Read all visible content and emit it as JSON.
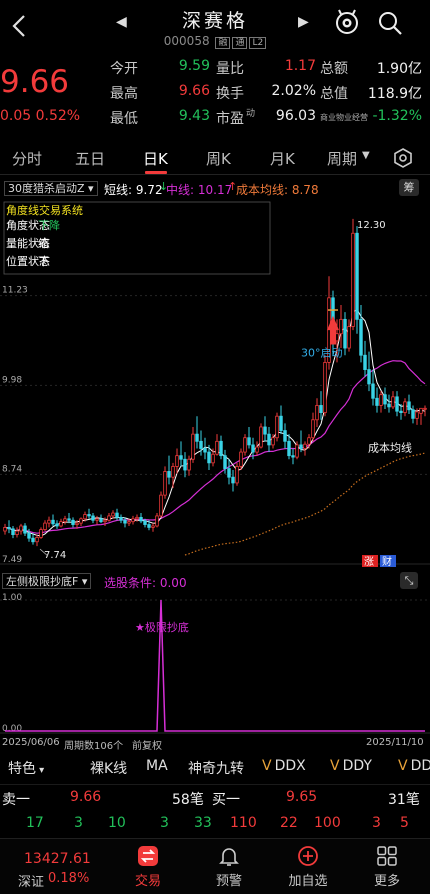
{
  "header": {
    "title": "深赛格",
    "code": "000058",
    "tags": [
      "融",
      "通",
      "L2"
    ]
  },
  "quote": {
    "price": "9.66",
    "change": "0.05",
    "change_pct": "0.52%",
    "rows": [
      {
        "l1": "今开",
        "v1": "9.59",
        "c1": "green",
        "l2": "量比",
        "v2": "1.17",
        "c2": "red",
        "l3": "总额",
        "v3": "1.90亿",
        "c3": "white"
      },
      {
        "l1": "最高",
        "v1": "9.66",
        "c1": "red",
        "l2": "换手",
        "v2": "2.02%",
        "c2": "white",
        "l3": "总值",
        "v3": "118.9亿",
        "c3": "white"
      },
      {
        "l1": "最低",
        "v1": "9.43",
        "c1": "green",
        "l2": "市盈",
        "v2": "96.03",
        "c2": "white",
        "l3": "商业物业经营",
        "v3": "-1.32%",
        "c3": "green"
      }
    ],
    "pe_sup": "动"
  },
  "tabs": [
    "分时",
    "五日",
    "日K",
    "周K",
    "月K",
    "周期"
  ],
  "active_tab": "日K",
  "indicator": {
    "name": "30度猎杀启动Z",
    "short_label": "短线: 9.72",
    "mid_label": "中线: 10.17",
    "cost_label": "成本均线: 8.78",
    "side_btn": "筹"
  },
  "overlay": {
    "title": "角度线交易系统",
    "rows": [
      "角度状态",
      "量能状态",
      "位置状态"
    ],
    "vals": [
      "下降",
      "缩",
      "下"
    ],
    "launch": "30°启动",
    "cost_avg": "成本均线",
    "zhang": "涨",
    "cai": "财",
    "max_label": "12.30",
    "min_label": "7.74"
  },
  "chart_data": [
    {
      "type": "candlestick",
      "title": "30度猎杀启动Z",
      "y_ticks": [
        "11.23",
        "9.98",
        "8.74",
        "7.49"
      ],
      "ylim": [
        7.49,
        12.48
      ],
      "x_start": "2025/06/06",
      "x_end": "2025/11/10",
      "period_count": "周期数106个",
      "adjust": "前复权",
      "high_marker": "12.30",
      "low_marker": "7.74",
      "series": [
        {
          "name": "短线",
          "value": 9.72,
          "color": "#ffffff"
        },
        {
          "name": "中线",
          "value": 10.17,
          "color": "#d62fd6"
        },
        {
          "name": "成本均线",
          "value": 8.78,
          "color": "#c86f1e"
        }
      ],
      "candles": [
        [
          7.95,
          8.05,
          7.9,
          8.0
        ],
        [
          8.0,
          8.1,
          7.92,
          7.98
        ],
        [
          7.98,
          8.02,
          7.85,
          7.9
        ],
        [
          7.9,
          8.0,
          7.86,
          7.95
        ],
        [
          7.95,
          8.05,
          7.9,
          8.02
        ],
        [
          8.02,
          8.06,
          7.88,
          7.92
        ],
        [
          7.92,
          7.98,
          7.8,
          7.85
        ],
        [
          7.85,
          7.92,
          7.76,
          7.8
        ],
        [
          7.8,
          7.9,
          7.74,
          7.86
        ],
        [
          7.86,
          8.0,
          7.84,
          7.97
        ],
        [
          7.97,
          8.1,
          7.95,
          8.06
        ],
        [
          8.06,
          8.15,
          8.0,
          8.1
        ],
        [
          8.1,
          8.18,
          8.02,
          8.05
        ],
        [
          8.05,
          8.1,
          7.98,
          8.02
        ],
        [
          8.02,
          8.12,
          8.0,
          8.08
        ],
        [
          8.08,
          8.16,
          8.04,
          8.12
        ],
        [
          8.12,
          8.2,
          8.06,
          8.1
        ],
        [
          8.1,
          8.14,
          8.0,
          8.04
        ],
        [
          8.04,
          8.1,
          7.98,
          8.06
        ],
        [
          8.06,
          8.14,
          8.02,
          8.12
        ],
        [
          8.12,
          8.22,
          8.08,
          8.18
        ],
        [
          8.18,
          8.26,
          8.12,
          8.16
        ],
        [
          8.16,
          8.2,
          8.06,
          8.1
        ],
        [
          8.1,
          8.16,
          8.04,
          8.12
        ],
        [
          8.12,
          8.18,
          8.06,
          8.08
        ],
        [
          8.08,
          8.14,
          8.02,
          8.1
        ],
        [
          8.1,
          8.2,
          8.08,
          8.16
        ],
        [
          8.16,
          8.24,
          8.12,
          8.2
        ],
        [
          8.2,
          8.26,
          8.1,
          8.14
        ],
        [
          8.14,
          8.18,
          8.06,
          8.1
        ],
        [
          8.1,
          8.14,
          8.0,
          8.06
        ],
        [
          8.06,
          8.12,
          8.02,
          8.08
        ],
        [
          8.08,
          8.16,
          8.04,
          8.12
        ],
        [
          8.12,
          8.18,
          8.08,
          8.14
        ],
        [
          8.14,
          8.2,
          8.06,
          8.09
        ],
        [
          8.09,
          8.12,
          8.0,
          8.04
        ],
        [
          8.04,
          8.1,
          7.96,
          8.0
        ],
        [
          8.0,
          8.06,
          7.94,
          8.02
        ],
        [
          8.02,
          8.2,
          8.0,
          8.16
        ],
        [
          8.16,
          8.5,
          8.14,
          8.45
        ],
        [
          8.45,
          8.85,
          8.4,
          8.78
        ],
        [
          8.78,
          9.0,
          8.6,
          8.7
        ],
        [
          8.7,
          8.9,
          8.55,
          8.85
        ],
        [
          8.85,
          9.1,
          8.75,
          9.0
        ],
        [
          9.0,
          9.2,
          8.85,
          8.95
        ],
        [
          8.95,
          9.05,
          8.7,
          8.8
        ],
        [
          8.8,
          9.0,
          8.72,
          8.95
        ],
        [
          8.95,
          9.4,
          8.9,
          9.3
        ],
        [
          9.3,
          9.55,
          9.1,
          9.2
        ],
        [
          9.2,
          9.35,
          9.0,
          9.1
        ],
        [
          9.1,
          9.25,
          8.95,
          9.05
        ],
        [
          9.05,
          9.15,
          8.8,
          8.9
        ],
        [
          8.9,
          9.1,
          8.85,
          9.02
        ],
        [
          9.02,
          9.3,
          9.0,
          9.2
        ],
        [
          9.2,
          9.28,
          8.95,
          9.0
        ],
        [
          9.0,
          9.08,
          8.75,
          8.82
        ],
        [
          8.82,
          8.95,
          8.6,
          8.7
        ],
        [
          8.7,
          8.8,
          8.5,
          8.62
        ],
        [
          8.62,
          8.9,
          8.58,
          8.85
        ],
        [
          8.85,
          9.1,
          8.8,
          9.05
        ],
        [
          9.05,
          9.3,
          9.0,
          9.25
        ],
        [
          9.25,
          9.4,
          9.1,
          9.15
        ],
        [
          9.15,
          9.25,
          8.95,
          9.05
        ],
        [
          9.05,
          9.2,
          9.0,
          9.12
        ],
        [
          9.12,
          9.45,
          9.1,
          9.4
        ],
        [
          9.4,
          9.55,
          9.2,
          9.3
        ],
        [
          9.3,
          9.4,
          9.05,
          9.15
        ],
        [
          9.15,
          9.3,
          9.1,
          9.25
        ],
        [
          9.25,
          9.6,
          9.2,
          9.55
        ],
        [
          9.55,
          9.7,
          9.3,
          9.35
        ],
        [
          9.35,
          9.45,
          9.1,
          9.2
        ],
        [
          9.2,
          9.3,
          8.95,
          9.0
        ],
        [
          9.0,
          9.1,
          8.88,
          8.98
        ],
        [
          8.98,
          9.2,
          8.95,
          9.15
        ],
        [
          9.15,
          9.35,
          9.05,
          9.1
        ],
        [
          9.1,
          9.2,
          9.0,
          9.16
        ],
        [
          9.16,
          9.3,
          9.1,
          9.25
        ],
        [
          9.25,
          9.6,
          9.2,
          9.5
        ],
        [
          9.5,
          9.8,
          9.4,
          9.7
        ],
        [
          9.7,
          9.9,
          9.5,
          9.6
        ],
        [
          9.6,
          10.4,
          9.55,
          10.3
        ],
        [
          10.3,
          11.5,
          10.2,
          11.2
        ],
        [
          11.2,
          11.3,
          10.4,
          10.6
        ],
        [
          10.6,
          10.9,
          10.3,
          10.7
        ],
        [
          10.7,
          11.1,
          10.5,
          10.9
        ],
        [
          10.9,
          11.0,
          10.4,
          10.5
        ],
        [
          10.5,
          10.9,
          10.45,
          10.8
        ],
        [
          10.8,
          12.3,
          10.75,
          12.1
        ],
        [
          12.1,
          12.2,
          10.7,
          10.9
        ],
        [
          10.9,
          11.1,
          10.3,
          10.4
        ],
        [
          10.4,
          10.6,
          10.1,
          10.2
        ],
        [
          10.2,
          10.45,
          9.9,
          10.0
        ],
        [
          10.0,
          10.2,
          9.7,
          9.8
        ],
        [
          9.8,
          9.95,
          9.6,
          9.7
        ],
        [
          9.7,
          9.9,
          9.6,
          9.85
        ],
        [
          9.85,
          9.95,
          9.65,
          9.72
        ],
        [
          9.72,
          9.85,
          9.6,
          9.68
        ],
        [
          9.68,
          9.9,
          9.65,
          9.82
        ],
        [
          9.82,
          9.9,
          9.55,
          9.62
        ],
        [
          9.62,
          9.72,
          9.5,
          9.6
        ],
        [
          9.6,
          9.8,
          9.55,
          9.75
        ],
        [
          9.75,
          9.85,
          9.58,
          9.64
        ],
        [
          9.64,
          9.7,
          9.45,
          9.52
        ],
        [
          9.52,
          9.66,
          9.43,
          9.61
        ],
        [
          9.59,
          9.66,
          9.43,
          9.66
        ],
        [
          9.66,
          9.7,
          9.55,
          9.66
        ]
      ]
    },
    {
      "type": "line",
      "title": "左侧极限抄底F",
      "condition_label": "选股条件: 0.00",
      "y_ticks": [
        "1.00",
        "0.00"
      ],
      "ylim": [
        0,
        1
      ],
      "spike_index": 39,
      "annotation": "★极限抄底",
      "n": 106
    }
  ],
  "feature_bar": [
    "特色",
    "裸K线",
    "MA",
    "神奇九转",
    "DDX",
    "DDY",
    "DD"
  ],
  "orderbook": {
    "sell_label": "卖一",
    "sell_price": "9.66",
    "sell_qty": "58笔",
    "buy_label": "买一",
    "buy_price": "9.65",
    "buy_qty": "31笔",
    "sell_detail": [
      "17",
      "3",
      "10",
      "3",
      "33"
    ],
    "buy_detail": [
      "110",
      "22",
      "100",
      "3",
      "5"
    ]
  },
  "nav": {
    "index_value": "13427.61",
    "index_name": "深证",
    "index_pct": "0.18%",
    "items": [
      "交易",
      "预警",
      "加自选",
      "更多"
    ]
  },
  "colors": {
    "up": "#f23b3b",
    "down": "#22c05a",
    "mid": "#d62fd6",
    "short": "#ffffff",
    "cost": "#c86f1e",
    "accent": "#f23b3b",
    "cyan": "#33d6e8"
  }
}
